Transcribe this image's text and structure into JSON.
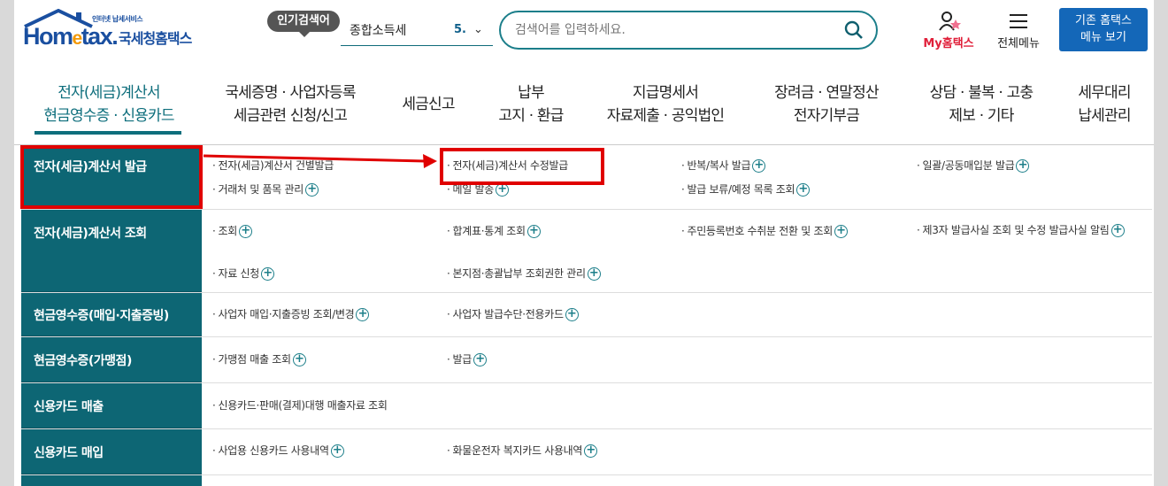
{
  "header": {
    "logo_small": "인터넷 납세서비스",
    "logo_main_pre": "Hom",
    "logo_main_e": "e",
    "logo_main_post": "tax.",
    "logo_sub": "국세청홈택스",
    "popular_label": "인기검색어",
    "popular_keyword": "종합소득세",
    "popular_rank": "5.",
    "search_placeholder": "검색어를 입력하세요.",
    "my_hometax": "My홈택스",
    "all_menu": "전체메뉴",
    "legacy_line1": "기존 홈택스",
    "legacy_line2": "메뉴 보기"
  },
  "nav": [
    {
      "line1": "전자(세금)계산서",
      "line2": "현금영수증 · 신용카드"
    },
    {
      "line1": "국세증명 · 사업자등록",
      "line2": "세금관련 신청/신고"
    },
    {
      "line1": "세금신고",
      "line2": ""
    },
    {
      "line1": "납부",
      "line2": "고지 · 환급"
    },
    {
      "line1": "지급명세서",
      "line2": "자료제출 · 공익법인"
    },
    {
      "line1": "장려금 · 연말정산",
      "line2": "전자기부금"
    },
    {
      "line1": "상담 · 불복 · 고충",
      "line2": "제보 · 기타"
    },
    {
      "line1": "세무대리",
      "line2": "납세관리"
    }
  ],
  "menu": {
    "rows": [
      {
        "category": "전자(세금)계산서 발급",
        "links": [
          "전자(세금)계산서 건별발급",
          "전자(세금)계산서 수정발급",
          "반복/복사 발급",
          "일괄/공동매입분 발급",
          "거래처 및 품목 관리",
          "메일 발송",
          "발급 보류/예정 목록 조회"
        ]
      },
      {
        "category": "전자(세금)계산서 조회",
        "links": [
          "조회",
          "합계표·통계 조회",
          "주민등록번호 수취분 전환 및 조회",
          "제3자 발급사실 조회 및 수정 발급사실 알림",
          "자료 신청",
          "본지점·총괄납부 조회권한 관리"
        ]
      },
      {
        "category": "현금영수증(매입·지출증빙)",
        "links": [
          "사업자 매입·지출증빙 조회/변경",
          "사업자 발급수단·전용카드"
        ]
      },
      {
        "category": "현금영수증(가맹점)",
        "links": [
          "가맹점 매출 조회",
          "발급"
        ]
      },
      {
        "category": "신용카드 매출",
        "links": [
          "신용카드·판매(결제)대행 매출자료 조회"
        ]
      },
      {
        "category": "신용카드 매입",
        "links": [
          "사업용 신용카드 사용내역",
          "화물운전자 복지카드 사용내역"
        ]
      }
    ]
  },
  "colors": {
    "accent": "#0d6674",
    "highlight": "#e00000",
    "brand_blue": "#1a4fa0",
    "legacy_button": "#1467b8"
  }
}
